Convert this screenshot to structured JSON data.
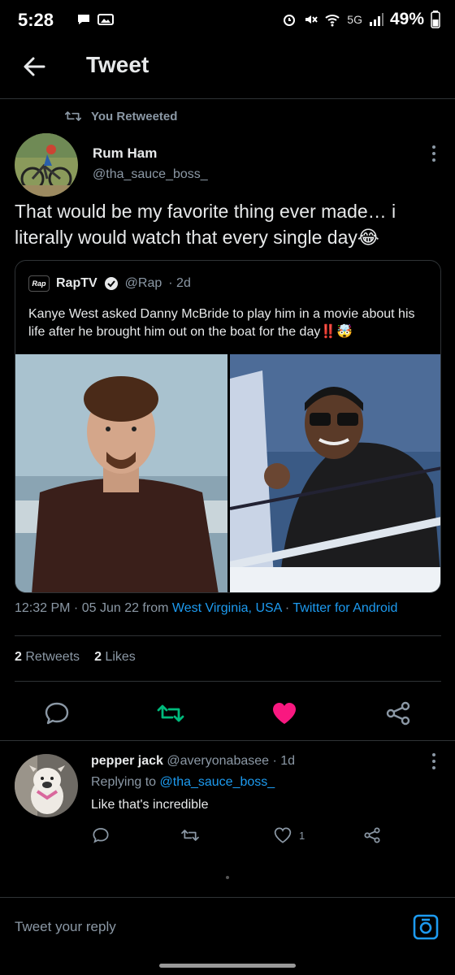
{
  "status_bar": {
    "time": "5:28",
    "network": "5G",
    "battery": "49%"
  },
  "header": {
    "title": "Tweet"
  },
  "retweet_note": "You Retweeted",
  "tweet": {
    "author_name": "Rum Ham",
    "author_handle": "@tha_sauce_boss_",
    "text": "That would be my favorite thing ever made… i literally would watch that every single day😂",
    "quote": {
      "logo_text": "Rap",
      "name": "RapTV",
      "handle": "@Rap",
      "age": "· 2d",
      "text": "Kanye West asked Danny McBride to play him in a movie about his life after he brought him out on the boat for the day‼️🤯"
    },
    "meta": {
      "time": "12:32 PM",
      "sep1": " · ",
      "date": "05 Jun 22",
      "from": " from ",
      "location": "West Virginia, USA",
      "sep2": " · ",
      "client": "Twitter for Android"
    },
    "stats": {
      "retweets_count": "2",
      "retweets_label": "Retweets",
      "likes_count": "2",
      "likes_label": "Likes"
    }
  },
  "reply": {
    "name": "pepper jack",
    "handle": "@averyonabasee",
    "age": "· 1d",
    "replying_prefix": "Replying to ",
    "replying_to": "@tha_sauce_boss_",
    "text": "Like that's incredible",
    "like_count": "1"
  },
  "compose": {
    "placeholder": "Tweet your reply"
  },
  "colors": {
    "background": "#000000",
    "text": "#e7e9ea",
    "muted": "#8b98a5",
    "link": "#1d9bf0",
    "retweet_active": "#00ba7c",
    "like_active": "#f91880",
    "border": "#2f3336"
  },
  "icons": {
    "back": "arrow-left-icon",
    "retweet": "retweet-icon",
    "more": "more-vertical-icon",
    "verified": "verified-badge-icon",
    "reply": "comment-icon",
    "like": "heart-icon",
    "share": "share-icon",
    "camera": "camera-icon"
  }
}
